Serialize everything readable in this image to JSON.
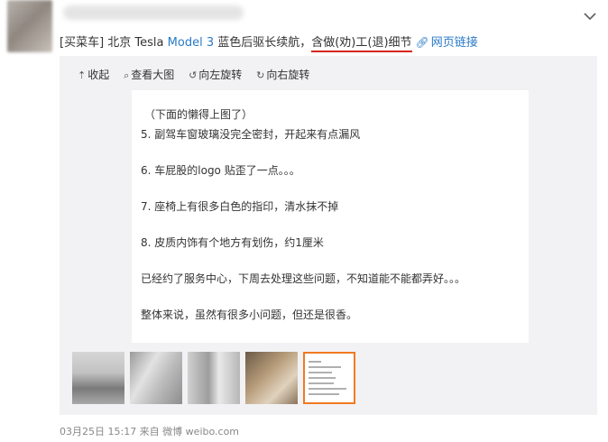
{
  "post": {
    "headline": {
      "tag": "[买菜车]",
      "text_a": "北京 Tesla ",
      "model": "Model 3",
      "text_b": " 蓝色后驱长续航，",
      "highlight": "含做(劝)工(退)细节",
      "link_label": "网页链接",
      "link_icon": "link-icon"
    },
    "toolbar": {
      "collapse": "收起",
      "view_large": "查看大图",
      "rotate_left": "向左旋转",
      "rotate_right": "向右旋转"
    },
    "image_text": [
      "（下面的懒得上图了）",
      "5. 副驾车窗玻璃没完全密封，开起来有点漏风",
      "6. 车屁股的logo 贴歪了一点。。。",
      "7. 座椅上有很多白色的指印，清水抹不掉",
      "8. 皮质内饰有个地方有划伤，约1厘米",
      "已经约了服务中心，下周去处理这些问题，不知道能不能都弄好。。。",
      "整体来说，虽然有很多小问题，但还是很香。"
    ],
    "footer": "03月25日 15:17 来自 微博 weibo.com"
  },
  "colors": {
    "link": "#2a7ac7",
    "underline": "#d8261f",
    "selected_thumb": "#f07a21",
    "media_bg": "#f2f2f5"
  }
}
